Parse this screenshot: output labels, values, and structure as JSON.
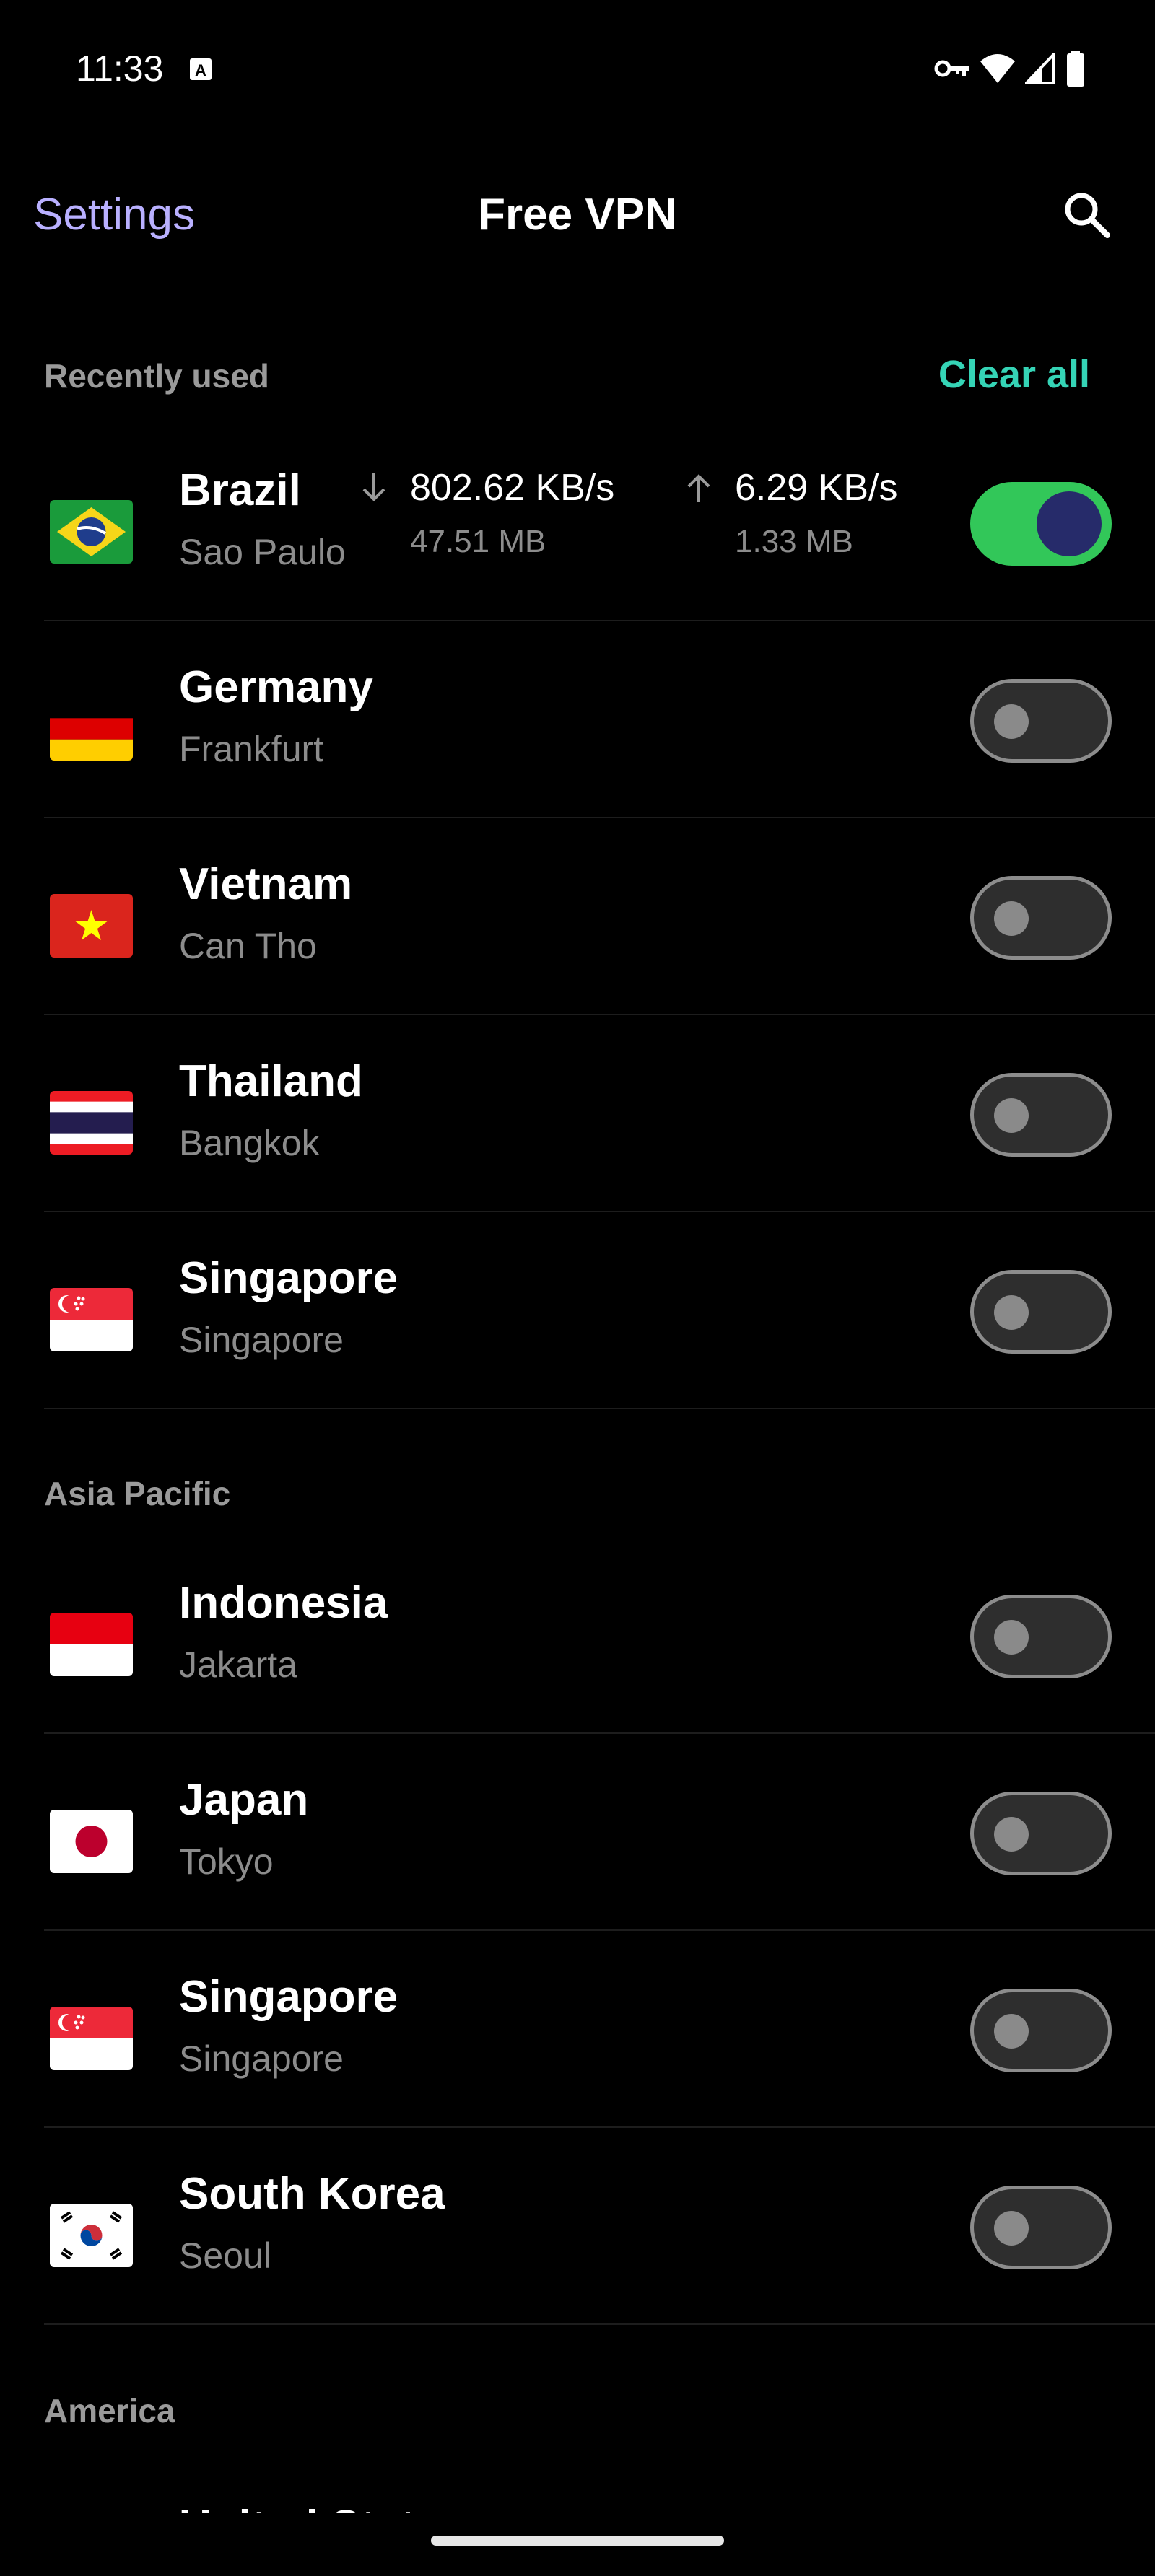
{
  "status_bar": {
    "time": "11:33",
    "icons": [
      "font-notification-icon",
      "vpn-key-icon",
      "wifi-icon",
      "signal-icon",
      "battery-icon"
    ]
  },
  "header": {
    "settings_label": "Settings",
    "title": "Free VPN",
    "search_icon": "search-icon"
  },
  "recently_used": {
    "title": "Recently used",
    "clear_all_label": "Clear all",
    "items": [
      {
        "country": "Brazil",
        "city": "Sao Paulo",
        "flag": "brazil-flag-icon",
        "connected": true,
        "download_rate": "802.62 KB/s",
        "download_total": "47.51 MB",
        "upload_rate": "6.29 KB/s",
        "upload_total": "1.33 MB"
      },
      {
        "country": "Germany",
        "city": "Frankfurt",
        "flag": "germany-flag-icon",
        "connected": false
      },
      {
        "country": "Vietnam",
        "city": "Can Tho",
        "flag": "vietnam-flag-icon",
        "connected": false
      },
      {
        "country": "Thailand",
        "city": "Bangkok",
        "flag": "thailand-flag-icon",
        "connected": false
      },
      {
        "country": "Singapore",
        "city": "Singapore",
        "flag": "singapore-flag-icon",
        "connected": false
      }
    ]
  },
  "asia_pacific": {
    "title": "Asia Pacific",
    "items": [
      {
        "country": "Indonesia",
        "city": "Jakarta",
        "flag": "indonesia-flag-icon",
        "connected": false
      },
      {
        "country": "Japan",
        "city": "Tokyo",
        "flag": "japan-flag-icon",
        "connected": false
      },
      {
        "country": "Singapore",
        "city": "Singapore",
        "flag": "singapore-flag-icon",
        "connected": false
      },
      {
        "country": "South Korea",
        "city": "Seoul",
        "flag": "south-korea-flag-icon",
        "connected": false
      }
    ]
  },
  "america": {
    "title": "America",
    "partial_item_country": "United States"
  },
  "colors": {
    "accent_link": "#b9b0ff",
    "clear_all": "#35d4b6",
    "toggle_on": "#32c759",
    "toggle_knob_on": "#262b6a"
  }
}
